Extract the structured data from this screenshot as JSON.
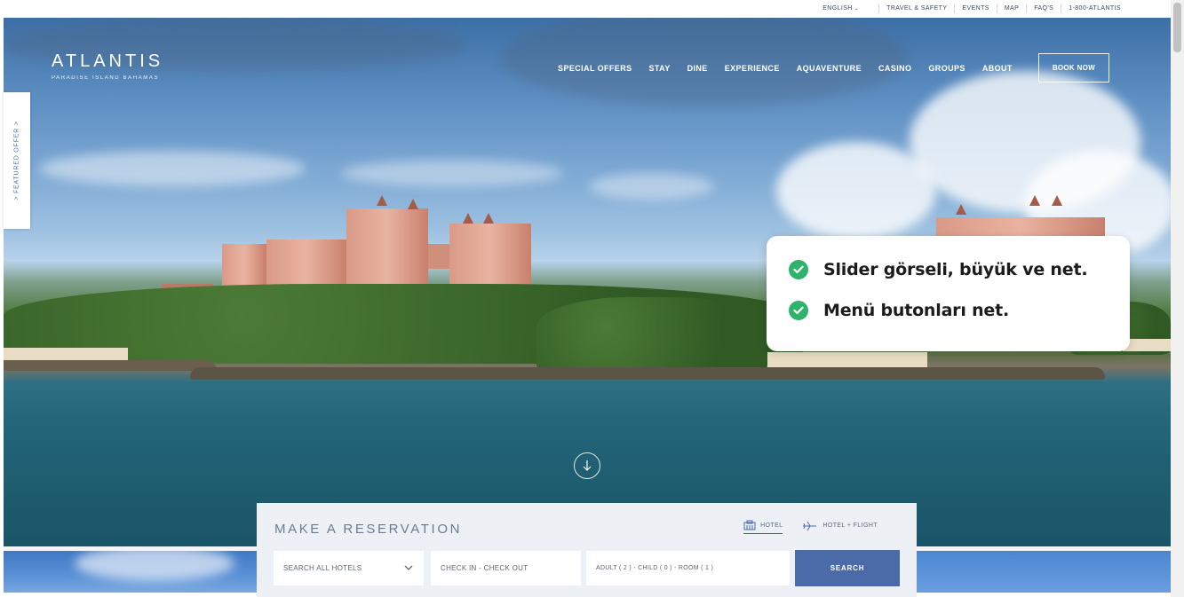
{
  "topbar": {
    "language": "ENGLISH",
    "links": [
      "TRAVEL & SAFETY",
      "EVENTS",
      "MAP",
      "FAQ'S",
      "1-800-ATLANTIS"
    ]
  },
  "logo": {
    "title": "ATLANTIS",
    "subtitle": "PARADISE ISLAND BAHAMAS"
  },
  "nav": {
    "items": [
      "SPECIAL OFFERS",
      "STAY",
      "DINE",
      "EXPERIENCE",
      "AQUAVENTURE",
      "CASINO",
      "GROUPS",
      "ABOUT"
    ],
    "cta": "BOOK NOW"
  },
  "featured_offer": {
    "label": "> FEATURED OFFER >"
  },
  "callout": {
    "points": [
      "Slider görseli, büyük ve net.",
      "Menü butonları net."
    ],
    "check_color": "#2fb36c"
  },
  "reservation": {
    "title": "MAKE A RESERVATION",
    "tabs": [
      "HOTEL",
      "HOTEL + FLIGHT"
    ],
    "hotel_select": "SEARCH ALL HOTELS",
    "dates": "CHECK IN - CHECK OUT",
    "guests": "ADULT ( 2 ) - CHILD ( 0 ) - ROOM ( 1 )",
    "search": "SEARCH",
    "accent": "#4a6aa8"
  }
}
